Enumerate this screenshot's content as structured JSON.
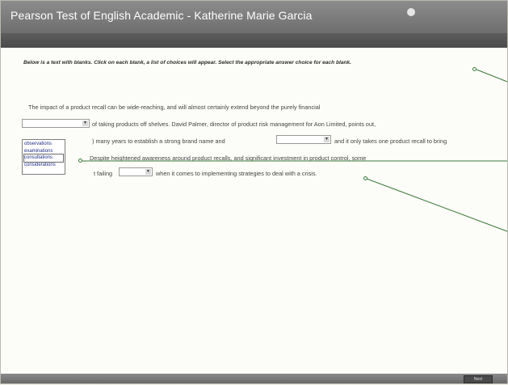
{
  "window": {
    "title": "Pearson Test of English Academic - Katherine Marie Garcia"
  },
  "instruction": "Below is a text with blanks. Click on each blank, a list of choices will appear. Select the appropriate answer choice for each blank.",
  "passage": {
    "line1": "The impact of a product recall can be wide-reaching, and will almost certainly extend beyond the purely financial",
    "line2_after": "of taking products off shelves. David Palmer, director of product risk management for Aon Limited, points out,",
    "line3_before": ") many years to establish a strong brand name and",
    "line3_after": "and it only takes one product recall to bring",
    "line4": "Despite heightened awareness around product recalls, and significant investment in product control, some",
    "line5_before": "t failing",
    "line5_after": "when it comes to implementing strategies to deal with a crisis."
  },
  "dropdown": {
    "options": [
      "observations",
      "examinations",
      "consultations",
      "considerations"
    ],
    "highlighted": "consultations"
  },
  "footer": {
    "next_label": "Next"
  }
}
